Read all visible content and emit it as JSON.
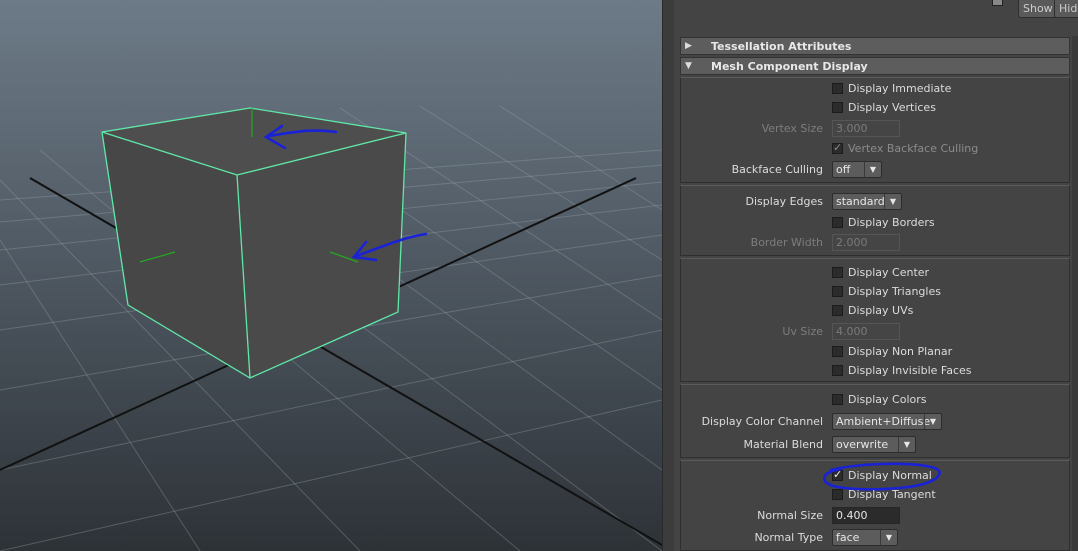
{
  "top_buttons": {
    "show": "Show",
    "hide": "Hide"
  },
  "sections": {
    "tessellation": "Tessellation Attributes",
    "mesh_component_display": "Mesh Component Display"
  },
  "mesh": {
    "display_immediate": {
      "label": "Display Immediate",
      "checked": false
    },
    "display_vertices": {
      "label": "Display Vertices",
      "checked": false
    },
    "vertex_size": {
      "label": "Vertex Size",
      "value": "3.000"
    },
    "vertex_backface_culling": {
      "label": "Vertex Backface Culling",
      "checked": true
    },
    "backface_culling": {
      "label": "Backface Culling",
      "value": "off"
    },
    "display_edges": {
      "label": "Display Edges",
      "value": "standard"
    },
    "display_borders": {
      "label": "Display Borders",
      "checked": false
    },
    "border_width": {
      "label": "Border Width",
      "value": "2.000"
    },
    "display_center": {
      "label": "Display Center",
      "checked": false
    },
    "display_triangles": {
      "label": "Display Triangles",
      "checked": false
    },
    "display_uvs": {
      "label": "Display UVs",
      "checked": false
    },
    "uv_size": {
      "label": "Uv Size",
      "value": "4.000"
    },
    "display_non_planar": {
      "label": "Display Non Planar",
      "checked": false
    },
    "display_invisible_faces": {
      "label": "Display Invisible Faces",
      "checked": false
    },
    "display_colors": {
      "label": "Display Colors",
      "checked": false
    },
    "display_color_channel": {
      "label": "Display Color Channel",
      "value": "Ambient+Diffuse"
    },
    "material_blend": {
      "label": "Material Blend",
      "value": "overwrite"
    },
    "display_normal": {
      "label": "Display Normal",
      "checked": true
    },
    "display_tangent": {
      "label": "Display Tangent",
      "checked": false
    },
    "normal_size": {
      "label": "Normal Size",
      "value": "0.400"
    },
    "normal_type": {
      "label": "Normal Type",
      "value": "face"
    }
  },
  "colors": {
    "wireframe_highlight": "#5fe8a8",
    "annotation": "#1a22d8",
    "normal_line": "#22aa22"
  }
}
